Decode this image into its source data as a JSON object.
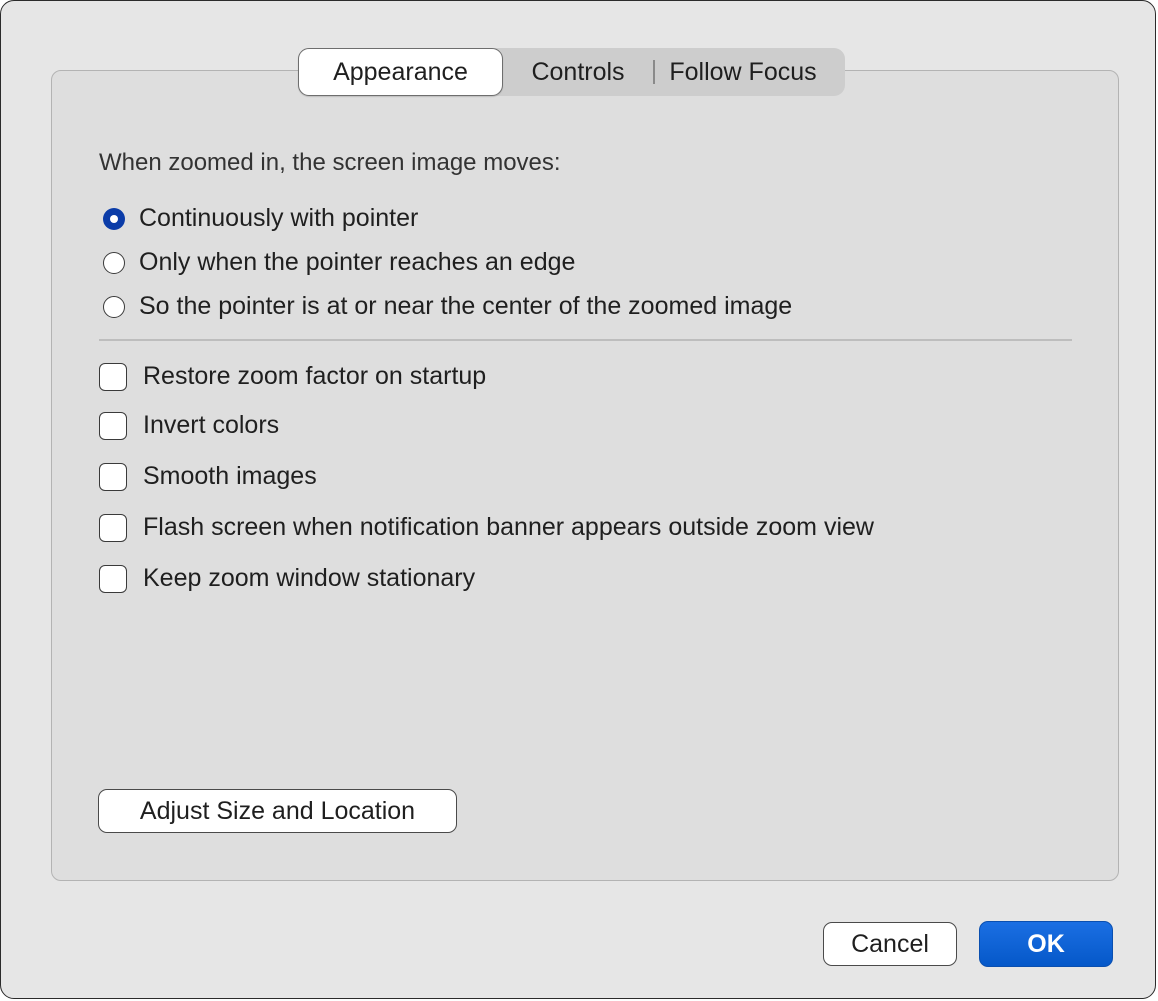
{
  "tabs": [
    {
      "label": "Appearance",
      "active": true
    },
    {
      "label": "Controls",
      "active": false
    },
    {
      "label": "Follow Focus",
      "active": false
    }
  ],
  "heading": "When zoomed in, the screen image moves:",
  "radios": [
    {
      "label": "Continuously with pointer",
      "selected": true
    },
    {
      "label": "Only when the pointer reaches an edge",
      "selected": false
    },
    {
      "label": "So the pointer is at or near the center of the zoomed image",
      "selected": false
    }
  ],
  "checkboxes": [
    {
      "label": "Restore zoom factor on startup",
      "checked": false
    },
    {
      "label": "Invert colors",
      "checked": false
    },
    {
      "label": "Smooth images",
      "checked": false
    },
    {
      "label": "Flash screen when notification banner appears outside zoom view",
      "checked": false
    },
    {
      "label": "Keep zoom window stationary",
      "checked": false
    }
  ],
  "adjust_button": "Adjust Size and Location",
  "footer": {
    "cancel_label": "Cancel",
    "ok_label": "OK"
  },
  "colors": {
    "accent": "#0b3ca8",
    "primary_button": "#0a5fd4"
  }
}
